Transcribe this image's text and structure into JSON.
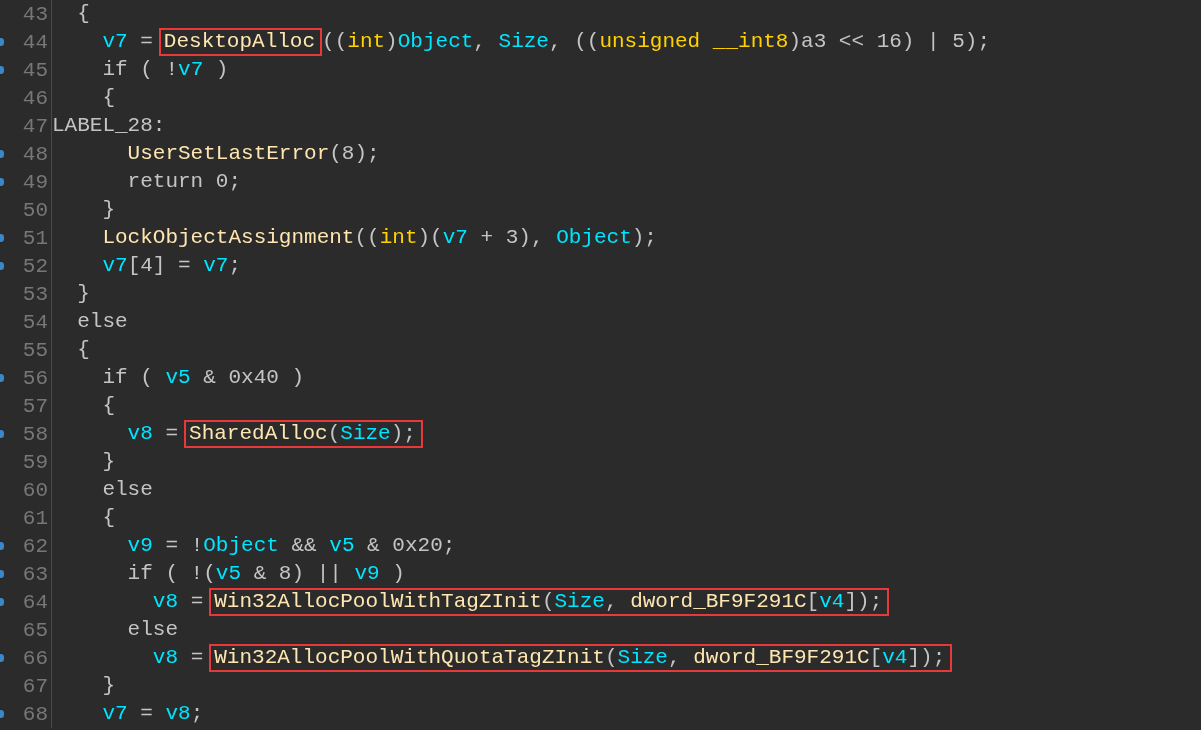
{
  "code_lines": [
    {
      "number": "43",
      "marked": false,
      "segments": [
        {
          "highlighted": false,
          "tokens": [
            {
              "kind": "plain",
              "text": "  {"
            }
          ]
        }
      ]
    },
    {
      "number": "44",
      "marked": true,
      "segments": [
        {
          "highlighted": false,
          "tokens": [
            {
              "kind": "var",
              "text": "    v7"
            },
            {
              "kind": "plain",
              "text": " ="
            }
          ]
        },
        {
          "highlighted": true,
          "tokens": [
            {
              "kind": "func",
              "text": "DesktopAlloc"
            }
          ]
        },
        {
          "highlighted": false,
          "tokens": [
            {
              "kind": "plain",
              "text": "(("
            },
            {
              "kind": "type",
              "text": "int"
            },
            {
              "kind": "plain",
              "text": ")"
            },
            {
              "kind": "var",
              "text": "Object"
            },
            {
              "kind": "plain",
              "text": ", "
            },
            {
              "kind": "var",
              "text": "Size"
            },
            {
              "kind": "plain",
              "text": ", (("
            },
            {
              "kind": "type",
              "text": "unsigned __int8"
            },
            {
              "kind": "plain",
              "text": ")a3 << 16) | 5);"
            }
          ]
        }
      ]
    },
    {
      "number": "45",
      "marked": true,
      "segments": [
        {
          "highlighted": false,
          "tokens": [
            {
              "kind": "plain",
              "text": "    if ( !"
            },
            {
              "kind": "var",
              "text": "v7"
            },
            {
              "kind": "plain",
              "text": " )"
            }
          ]
        }
      ]
    },
    {
      "number": "46",
      "marked": false,
      "segments": [
        {
          "highlighted": false,
          "tokens": [
            {
              "kind": "plain",
              "text": "    {"
            }
          ]
        }
      ]
    },
    {
      "number": "47",
      "marked": false,
      "segments": [
        {
          "highlighted": false,
          "tokens": [
            {
              "kind": "plain",
              "text": "LABEL_28:"
            }
          ]
        }
      ]
    },
    {
      "number": "48",
      "marked": true,
      "segments": [
        {
          "highlighted": false,
          "tokens": [
            {
              "kind": "func",
              "text": "      UserSetLastError"
            },
            {
              "kind": "plain",
              "text": "(8);"
            }
          ]
        }
      ]
    },
    {
      "number": "49",
      "marked": true,
      "segments": [
        {
          "highlighted": false,
          "tokens": [
            {
              "kind": "plain",
              "text": "      return 0;"
            }
          ]
        }
      ]
    },
    {
      "number": "50",
      "marked": false,
      "segments": [
        {
          "highlighted": false,
          "tokens": [
            {
              "kind": "plain",
              "text": "    }"
            }
          ]
        }
      ]
    },
    {
      "number": "51",
      "marked": true,
      "segments": [
        {
          "highlighted": false,
          "tokens": [
            {
              "kind": "func",
              "text": "    LockObjectAssignment"
            },
            {
              "kind": "plain",
              "text": "(("
            },
            {
              "kind": "type",
              "text": "int"
            },
            {
              "kind": "plain",
              "text": ")("
            },
            {
              "kind": "var",
              "text": "v7"
            },
            {
              "kind": "plain",
              "text": " + 3), "
            },
            {
              "kind": "var",
              "text": "Object"
            },
            {
              "kind": "plain",
              "text": ");"
            }
          ]
        }
      ]
    },
    {
      "number": "52",
      "marked": true,
      "segments": [
        {
          "highlighted": false,
          "tokens": [
            {
              "kind": "var",
              "text": "    v7"
            },
            {
              "kind": "plain",
              "text": "[4] = "
            },
            {
              "kind": "var",
              "text": "v7"
            },
            {
              "kind": "plain",
              "text": ";"
            }
          ]
        }
      ]
    },
    {
      "number": "53",
      "marked": false,
      "segments": [
        {
          "highlighted": false,
          "tokens": [
            {
              "kind": "plain",
              "text": "  }"
            }
          ]
        }
      ]
    },
    {
      "number": "54",
      "marked": false,
      "segments": [
        {
          "highlighted": false,
          "tokens": [
            {
              "kind": "plain",
              "text": "  else"
            }
          ]
        }
      ]
    },
    {
      "number": "55",
      "marked": false,
      "segments": [
        {
          "highlighted": false,
          "tokens": [
            {
              "kind": "plain",
              "text": "  {"
            }
          ]
        }
      ]
    },
    {
      "number": "56",
      "marked": true,
      "segments": [
        {
          "highlighted": false,
          "tokens": [
            {
              "kind": "plain",
              "text": "    if ( "
            },
            {
              "kind": "var",
              "text": "v5"
            },
            {
              "kind": "plain",
              "text": " & 0x40 )"
            }
          ]
        }
      ]
    },
    {
      "number": "57",
      "marked": false,
      "segments": [
        {
          "highlighted": false,
          "tokens": [
            {
              "kind": "plain",
              "text": "    {"
            }
          ]
        }
      ]
    },
    {
      "number": "58",
      "marked": true,
      "segments": [
        {
          "highlighted": false,
          "tokens": [
            {
              "kind": "var",
              "text": "      v8"
            },
            {
              "kind": "plain",
              "text": " ="
            }
          ]
        },
        {
          "highlighted": true,
          "tokens": [
            {
              "kind": "func",
              "text": "SharedAlloc"
            },
            {
              "kind": "plain",
              "text": "("
            },
            {
              "kind": "var",
              "text": "Size"
            },
            {
              "kind": "plain",
              "text": ");"
            }
          ]
        }
      ]
    },
    {
      "number": "59",
      "marked": false,
      "segments": [
        {
          "highlighted": false,
          "tokens": [
            {
              "kind": "plain",
              "text": "    }"
            }
          ]
        }
      ]
    },
    {
      "number": "60",
      "marked": false,
      "segments": [
        {
          "highlighted": false,
          "tokens": [
            {
              "kind": "plain",
              "text": "    else"
            }
          ]
        }
      ]
    },
    {
      "number": "61",
      "marked": false,
      "segments": [
        {
          "highlighted": false,
          "tokens": [
            {
              "kind": "plain",
              "text": "    {"
            }
          ]
        }
      ]
    },
    {
      "number": "62",
      "marked": true,
      "segments": [
        {
          "highlighted": false,
          "tokens": [
            {
              "kind": "var",
              "text": "      v9"
            },
            {
              "kind": "plain",
              "text": " = !"
            },
            {
              "kind": "var",
              "text": "Object"
            },
            {
              "kind": "plain",
              "text": " && "
            },
            {
              "kind": "var",
              "text": "v5"
            },
            {
              "kind": "plain",
              "text": " & 0x20;"
            }
          ]
        }
      ]
    },
    {
      "number": "63",
      "marked": true,
      "segments": [
        {
          "highlighted": false,
          "tokens": [
            {
              "kind": "plain",
              "text": "      if ( !("
            },
            {
              "kind": "var",
              "text": "v5"
            },
            {
              "kind": "plain",
              "text": " & 8) || "
            },
            {
              "kind": "var",
              "text": "v9"
            },
            {
              "kind": "plain",
              "text": " )"
            }
          ]
        }
      ]
    },
    {
      "number": "64",
      "marked": true,
      "segments": [
        {
          "highlighted": false,
          "tokens": [
            {
              "kind": "var",
              "text": "        v8"
            },
            {
              "kind": "plain",
              "text": " ="
            }
          ]
        },
        {
          "highlighted": true,
          "tokens": [
            {
              "kind": "func",
              "text": "Win32AllocPoolWithTagZInit"
            },
            {
              "kind": "plain",
              "text": "("
            },
            {
              "kind": "var",
              "text": "Size"
            },
            {
              "kind": "plain",
              "text": ", "
            },
            {
              "kind": "func",
              "text": "dword_BF9F291C"
            },
            {
              "kind": "plain",
              "text": "["
            },
            {
              "kind": "var",
              "text": "v4"
            },
            {
              "kind": "plain",
              "text": "]);"
            }
          ]
        }
      ]
    },
    {
      "number": "65",
      "marked": false,
      "segments": [
        {
          "highlighted": false,
          "tokens": [
            {
              "kind": "plain",
              "text": "      else"
            }
          ]
        }
      ]
    },
    {
      "number": "66",
      "marked": true,
      "segments": [
        {
          "highlighted": false,
          "tokens": [
            {
              "kind": "var",
              "text": "        v8"
            },
            {
              "kind": "plain",
              "text": " ="
            }
          ]
        },
        {
          "highlighted": true,
          "tokens": [
            {
              "kind": "func",
              "text": "Win32AllocPoolWithQuotaTagZInit"
            },
            {
              "kind": "plain",
              "text": "("
            },
            {
              "kind": "var",
              "text": "Size"
            },
            {
              "kind": "plain",
              "text": ", "
            },
            {
              "kind": "func",
              "text": "dword_BF9F291C"
            },
            {
              "kind": "plain",
              "text": "["
            },
            {
              "kind": "var",
              "text": "v4"
            },
            {
              "kind": "plain",
              "text": "]);"
            }
          ]
        }
      ]
    },
    {
      "number": "67",
      "marked": false,
      "segments": [
        {
          "highlighted": false,
          "tokens": [
            {
              "kind": "plain",
              "text": "    }"
            }
          ]
        }
      ]
    },
    {
      "number": "68",
      "marked": true,
      "segments": [
        {
          "highlighted": false,
          "tokens": [
            {
              "kind": "var",
              "text": "    v7"
            },
            {
              "kind": "plain",
              "text": " = "
            },
            {
              "kind": "var",
              "text": "v8"
            },
            {
              "kind": "plain",
              "text": ";"
            }
          ]
        }
      ]
    }
  ]
}
